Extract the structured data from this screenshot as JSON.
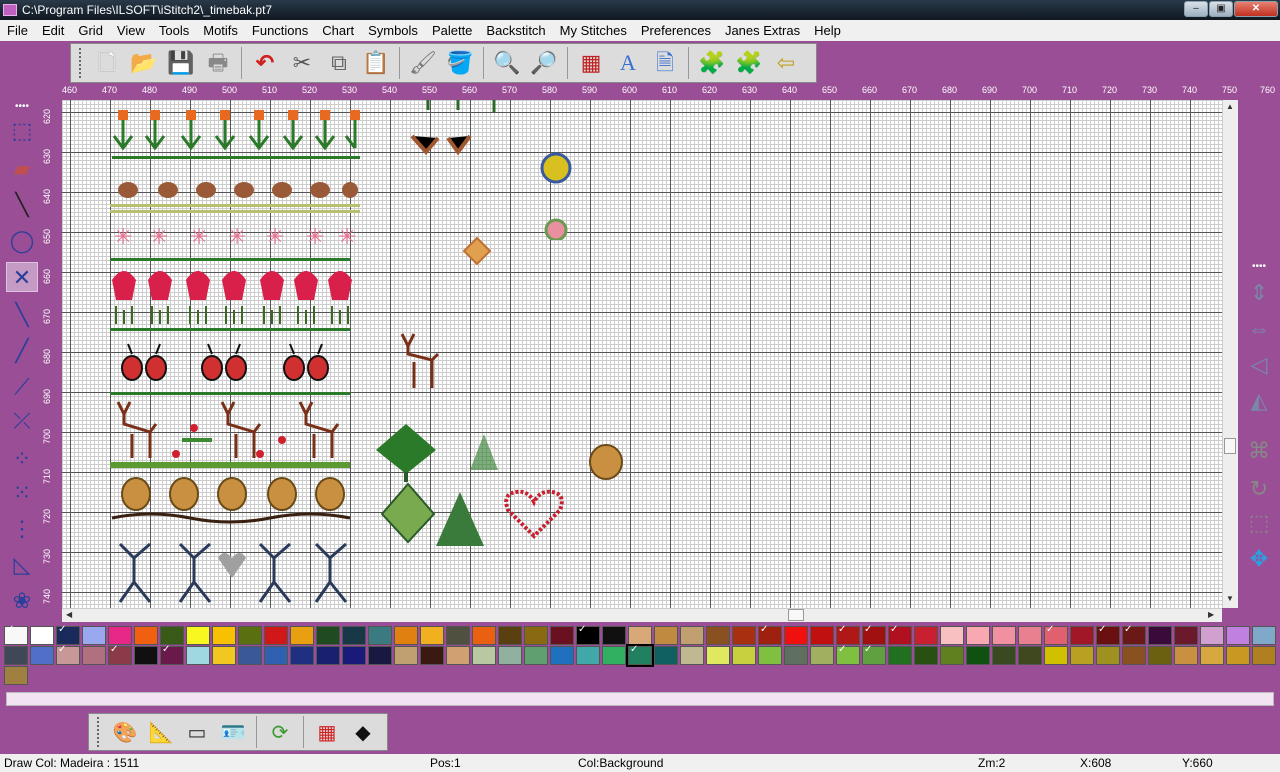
{
  "window": {
    "title": "C:\\Program Files\\ILSOFT\\iStitch2\\_timebak.pt7"
  },
  "menu": [
    "File",
    "Edit",
    "Grid",
    "View",
    "Tools",
    "Motifs",
    "Functions",
    "Chart",
    "Symbols",
    "Palette",
    "Backstitch",
    "My Stitches",
    "Preferences",
    "Janes Extras",
    "Help"
  ],
  "ruler": {
    "top_labels": [
      "460",
      "470",
      "480",
      "490",
      "500",
      "510",
      "520",
      "530",
      "540",
      "550",
      "560",
      "570",
      "580",
      "590",
      "600",
      "610",
      "620",
      "630",
      "640",
      "650",
      "660",
      "670",
      "680",
      "690",
      "700",
      "710",
      "720",
      "730",
      "740",
      "750",
      "760"
    ],
    "left_labels": [
      "620",
      "630",
      "640",
      "650",
      "660",
      "670",
      "680",
      "690",
      "700",
      "710",
      "720",
      "730",
      "740"
    ]
  },
  "palette_colors": [
    "#f8f8f8",
    "#ffffff",
    "#1a2a5a",
    "#9aa8f0",
    "#e82888",
    "#f06010",
    "#3a5a18",
    "#f8f820",
    "#f8c000",
    "#5a7010",
    "#d01818",
    "#e8a010",
    "#204a20",
    "#183848",
    "#3a7a80",
    "#e08010",
    "#f0b020",
    "#505040",
    "#e86010",
    "#5a4010",
    "#8a6a10",
    "#6a1020",
    "#000000",
    "#101010",
    "#d8a878",
    "#c08a40",
    "#c0a070",
    "#8a5020",
    "#a83010",
    "#a02010",
    "#f01010",
    "#c01010",
    "#b01818",
    "#a01010",
    "#b01020",
    "#c82030",
    "#f8c0c0",
    "#f8a8b0",
    "#f090a0",
    "#e88090",
    "#e06070",
    "#a01828",
    "#6a1010",
    "#6a1818",
    "#3a0a3a",
    "#6a1a2a",
    "#d0a0d0",
    "#c080e0",
    "#80a8c8",
    "#404858",
    "#5070c8",
    "#c89898",
    "#b07080",
    "#8a3a48",
    "#101010",
    "#6a1a4a",
    "#a0d8e0",
    "#f0c820",
    "#3a5898",
    "#3060b0",
    "#203080",
    "#1a2070",
    "#1a1a7a",
    "#181840",
    "#c0a070",
    "#3a1a10",
    "#d0a070",
    "#b8c8a0",
    "#90b0a0",
    "#60a070",
    "#2070c0",
    "#40a8a8",
    "#30b060",
    "#208060",
    "#106060",
    "#c0b890",
    "#e0e860",
    "#c8d040",
    "#80c040",
    "#607060",
    "#a0b060",
    "#80c040",
    "#60a040",
    "#207020",
    "#285010",
    "#608020",
    "#105010",
    "#3a4a20",
    "#404820",
    "#d0c000",
    "#b8a020",
    "#a09020",
    "#8a5020",
    "#6a6010",
    "#c89040",
    "#d8a840",
    "#c89820",
    "#b08020",
    "#a08040"
  ],
  "palette_marked": [
    0,
    2,
    22,
    29,
    32,
    33,
    34,
    40,
    42,
    43,
    51,
    53,
    55,
    73,
    81,
    82
  ],
  "palette_selected": 73,
  "status": {
    "draw_col": "Draw Col: Madeira : 1511",
    "pos": "Pos:1",
    "col": "Col:Background",
    "zoom": "Zm:2",
    "x": "X:608",
    "y": "Y:660"
  }
}
